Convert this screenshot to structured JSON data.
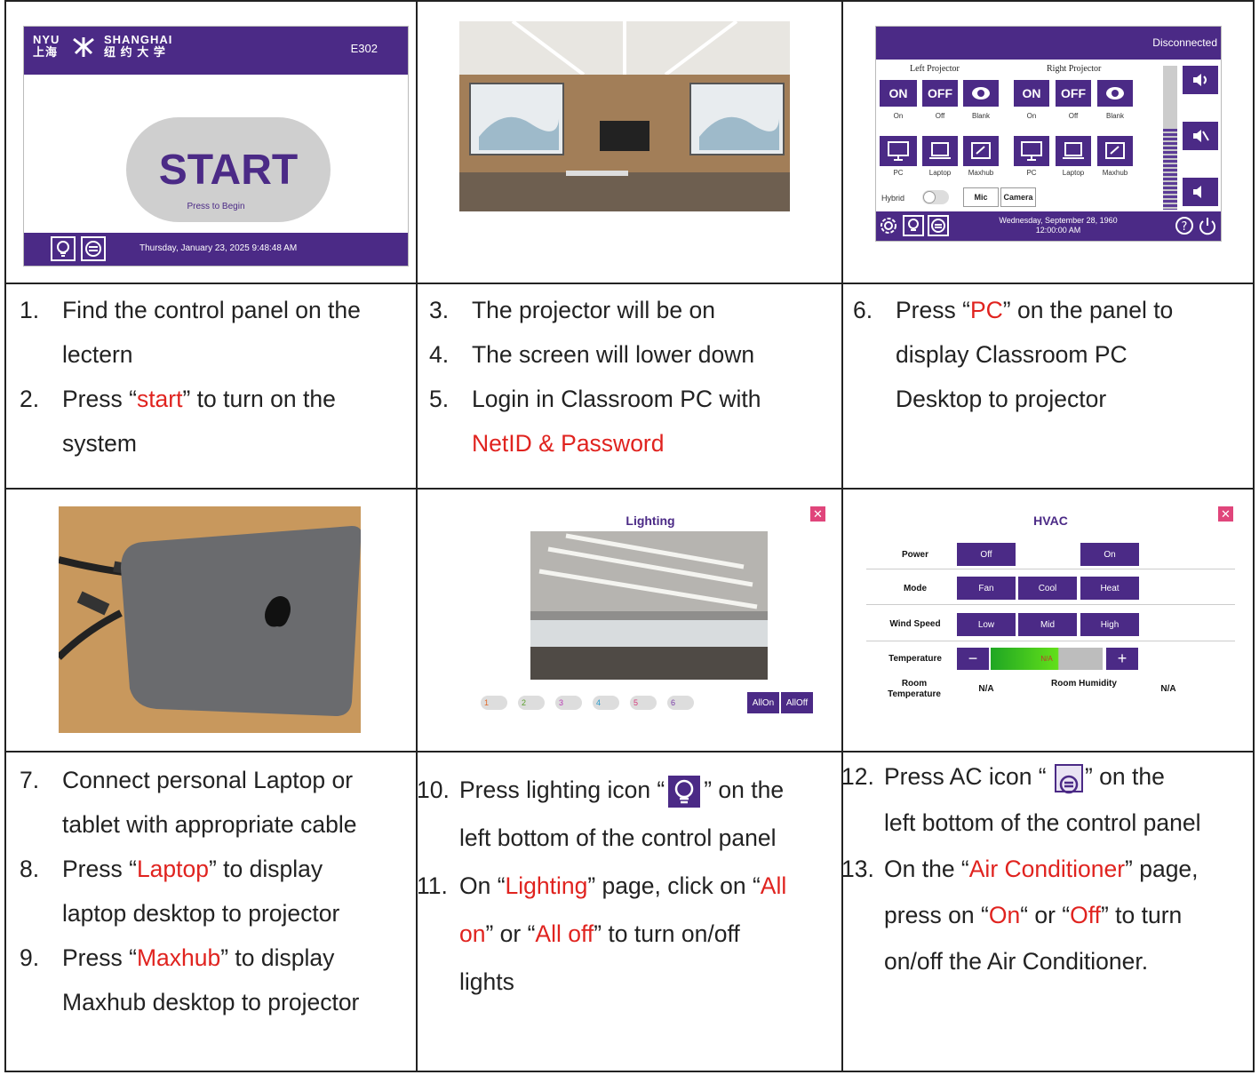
{
  "panel1": {
    "logo_nyu": "NYU",
    "logo_shanghai": "SHANGHAI",
    "logo_cn1": "上海",
    "logo_cn2": "纽 约 大 学",
    "room": "E302",
    "start": "START",
    "press_to_begin": "Press to Begin",
    "datetime": "Thursday, January 23, 2025 9:48:48 AM"
  },
  "panel3": {
    "status": "Disconnected",
    "left_projector": "Left Projector",
    "right_projector": "Right Projector",
    "on": "ON",
    "off": "OFF",
    "lbl_on": "On",
    "lbl_off": "Off",
    "lbl_blank": "Blank",
    "lbl_pc": "PC",
    "lbl_laptop": "Laptop",
    "lbl_maxhub": "Maxhub",
    "hybrid": "Hybrid",
    "mic": "Mic",
    "camera": "Camera",
    "datetime": "Wednesday, September 28, 1960 12:00:00 AM"
  },
  "lighting": {
    "title": "Lighting",
    "zones": [
      "1",
      "2",
      "3",
      "4",
      "5",
      "6"
    ],
    "all_on": "AllOn",
    "all_off": "AllOff"
  },
  "hvac": {
    "title": "HVAC",
    "power": "Power",
    "off": "Off",
    "on": "On",
    "mode": "Mode",
    "fan": "Fan",
    "cool": "Cool",
    "heat": "Heat",
    "wind_speed": "Wind Speed",
    "low": "Low",
    "mid": "Mid",
    "high": "High",
    "temperature": "Temperature",
    "temp_value": "N/A",
    "room_temperature": "Room Temperature",
    "room_temp_value": "N/A",
    "room_humidity": "Room Humidity",
    "room_humidity_value": "N/A"
  },
  "text": {
    "c1": {
      "i1_num": "1.",
      "i1_a": "Find the control panel on the",
      "i1_b": "lectern",
      "i2_num": "2.",
      "i2_pre": "Press “",
      "i2_red": "start",
      "i2_post": "” to turn on the",
      "i2_b": "system"
    },
    "c2": {
      "i3_num": "3.",
      "i3": "The projector will be on",
      "i4_num": "4.",
      "i4": "The screen will lower down",
      "i5_num": "5.",
      "i5": "Login in Classroom PC with",
      "i5_red": "NetID & Password"
    },
    "c3": {
      "i6_num": "6.",
      "i6_pre": "Press “",
      "i6_red": "PC",
      "i6_post": "” on the panel  to",
      "i6_b": "display Classroom PC",
      "i6_c": "Desktop to projector"
    },
    "c4": {
      "i7_num": "7.",
      "i7_a": "Connect personal Laptop or",
      "i7_b": "tablet with appropriate cable",
      "i8_num": "8.",
      "i8_pre": "Press “",
      "i8_red": "Laptop",
      "i8_post": "” to display",
      "i8_b": "laptop desktop to projector",
      "i9_num": "9.",
      "i9_pre": "Press “",
      "i9_red": "Maxhub",
      "i9_post": "” to display",
      "i9_b": "Maxhub desktop to projector"
    },
    "c5": {
      "i10_num": "10.",
      "i10_pre": "Press lighting icon “",
      "i10_post": "” on the",
      "i10_b": "left bottom of the control panel",
      "i11_num": "11.",
      "i11_pre": "On “",
      "i11_red": "Lighting",
      "i11_mid": "” page, click on “",
      "i11_red2": "All",
      "i11_red3": "on",
      "i11_mid2": "” or “",
      "i11_red4": "All off",
      "i11_post": "” to turn on/off",
      "i11_c": "lights"
    },
    "c6": {
      "i12_num": "12.",
      "i12_pre": "Press AC icon “ ",
      "i12_post": "” on the",
      "i12_b": "left bottom of the control panel",
      "i13_num": "13.",
      "i13_pre": "On the “",
      "i13_red": "Air Conditioner",
      "i13_post": "” page,",
      "i13_b_pre": "press on “",
      "i13_red2": "On",
      "i13_b_mid": "“ or “",
      "i13_red3": "Off",
      "i13_b_post": "” to turn",
      "i13_c": "on/off the Air Conditioner."
    }
  },
  "colors": {
    "accent": "#4b2a86",
    "highlight": "#e0231f",
    "close": "#e0457b"
  }
}
